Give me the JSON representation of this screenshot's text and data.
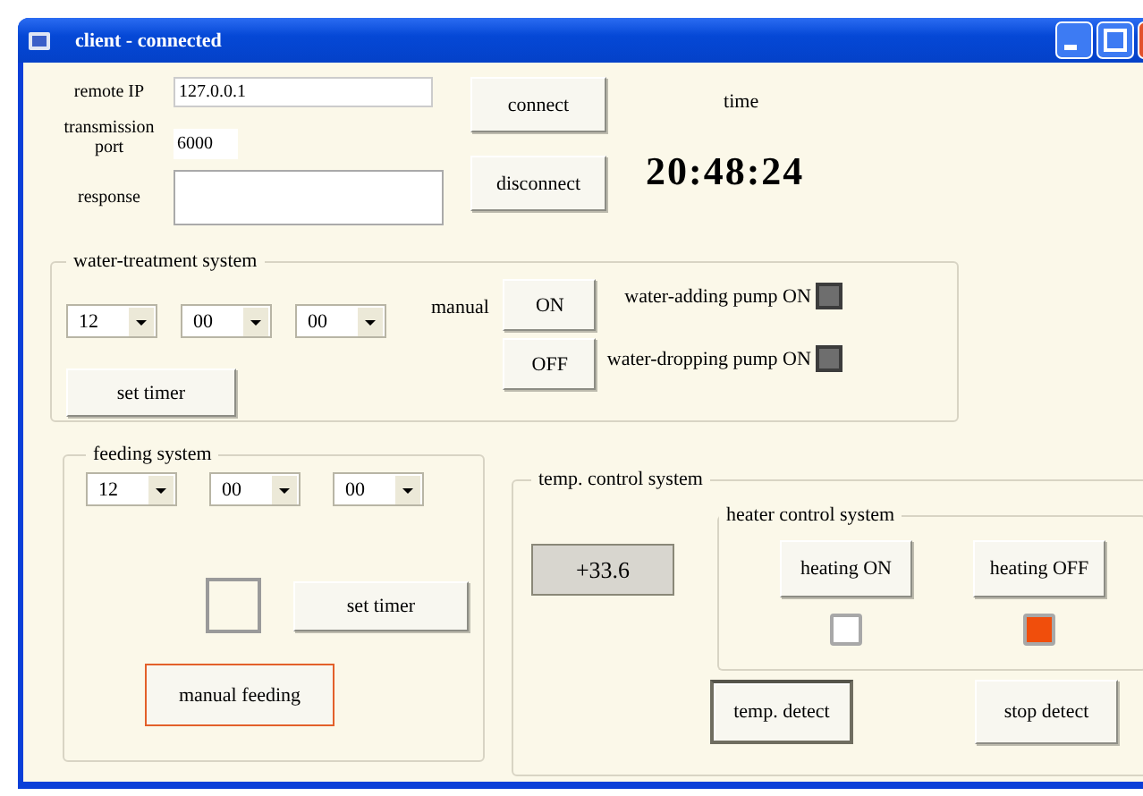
{
  "window": {
    "title": "client - connected"
  },
  "connection": {
    "fields": [
      {
        "label": "remote IP",
        "value": "127.0.0.1",
        "kind": "ip"
      },
      {
        "label": "transmission port",
        "value": "6000",
        "kind": "port"
      },
      {
        "label": "response",
        "kind": "response"
      }
    ],
    "buttons": [
      "connect",
      "disconnect"
    ],
    "time_label": "time",
    "time": "20:48:24"
  },
  "water_treatment": {
    "title": "water-treatment system",
    "timer": [
      "12",
      "00",
      "00"
    ],
    "set_timer": "set timer",
    "manual_label": "manual",
    "manual_buttons": [
      "ON",
      "OFF"
    ],
    "pumps": [
      {
        "label": "water-adding pump ON",
        "color": "#6e6e6e"
      },
      {
        "label": "water-dropping pump ON",
        "color": "#6e6e6e"
      }
    ]
  },
  "feeding": {
    "title": "feeding system",
    "timer": [
      "12",
      "00",
      "00"
    ],
    "set_timer": "set timer",
    "manual_button": {
      "label": "manual feeding",
      "focused": true
    }
  },
  "temperature": {
    "title": "temp. control system",
    "reading": "+33.6",
    "heater": {
      "title": "heater control system",
      "buttons": [
        {
          "label": "heating ON",
          "color": "#ffffff"
        },
        {
          "label": "heating OFF",
          "color": "#f04e0c"
        }
      ]
    },
    "detect_buttons": [
      {
        "label": "temp. detect",
        "pressed": true
      },
      {
        "label": "stop detect",
        "pressed": false
      }
    ]
  }
}
